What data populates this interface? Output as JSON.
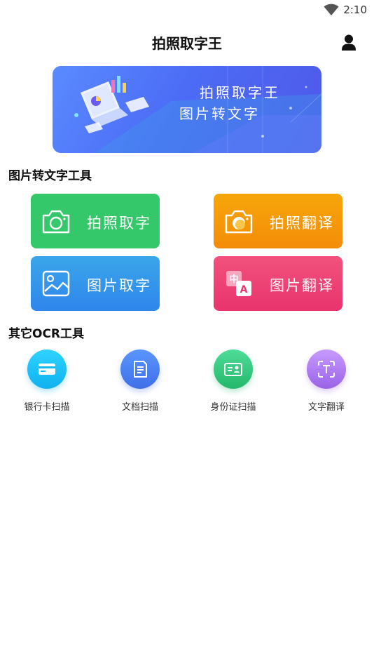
{
  "status_bar": {
    "time": "2:10"
  },
  "header": {
    "title": "拍照取字王"
  },
  "banner": {
    "line1": "拍照取字王",
    "line2": "图片转文字"
  },
  "sections": {
    "ocr_tools_title": "图片转文字工具",
    "other_tools_title": "其它OCR工具"
  },
  "tools": [
    {
      "label": "拍照取字",
      "icon": "camera-icon",
      "color": "#35c86a"
    },
    {
      "label": "拍照翻译",
      "icon": "camera-translate-icon",
      "color": "#f59a09"
    },
    {
      "label": "图片取字",
      "icon": "image-icon",
      "color": "#3196eb"
    },
    {
      "label": "图片翻译",
      "icon": "translate-icon",
      "color": "#ec4273"
    }
  ],
  "other_tools": [
    {
      "label": "银行卡扫描",
      "icon": "bank-card-icon",
      "color": "#19c2f5"
    },
    {
      "label": "文档扫描",
      "icon": "document-icon",
      "color": "#4e84f3"
    },
    {
      "label": "身份证扫描",
      "icon": "id-card-icon",
      "color": "#35c880"
    },
    {
      "label": "文字翻译",
      "icon": "text-scan-icon",
      "color": "#a77ae8"
    }
  ]
}
